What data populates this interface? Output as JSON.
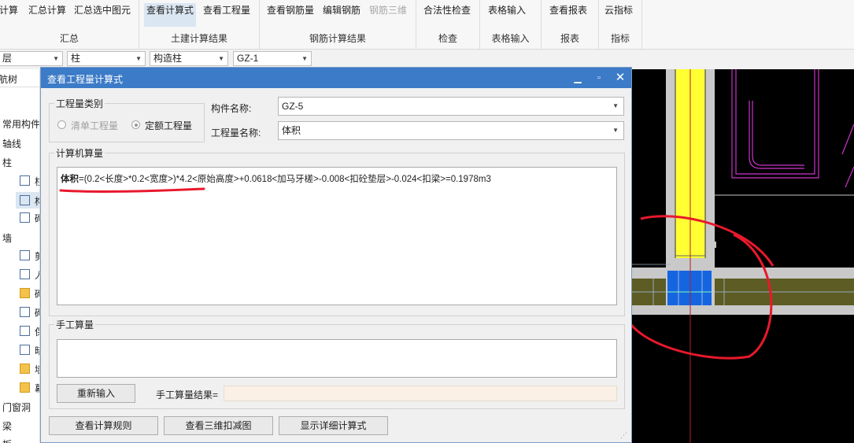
{
  "ribbon": {
    "groups": [
      {
        "label": "汇总",
        "buttons": [
          "计算",
          "汇总计算",
          "汇总选中图元"
        ]
      },
      {
        "label": "土建计算结果",
        "buttons": [
          "查看计算式",
          "查看工程量"
        ]
      },
      {
        "label": "钢筋计算结果",
        "buttons": [
          "查看钢筋量",
          "编辑钢筋",
          "钢筋三维"
        ]
      },
      {
        "label": "检查",
        "buttons": [
          "合法性检查"
        ]
      },
      {
        "label": "表格输入",
        "buttons": [
          "表格输入"
        ]
      },
      {
        "label": "报表",
        "buttons": [
          "查看报表"
        ]
      },
      {
        "label": "指标",
        "buttons": [
          "云指标"
        ]
      }
    ]
  },
  "selectors": [
    "层",
    "柱",
    "构造柱",
    "GZ-1"
  ],
  "nav": {
    "title": "航树",
    "items": [
      "常用构件",
      "轴线",
      "柱",
      "柱",
      "构",
      "砌",
      "墙",
      "剪",
      "人",
      "砌",
      "砌",
      "保",
      "暗",
      "墙",
      "幕",
      "门窗洞",
      "梁",
      "板"
    ]
  },
  "dialog": {
    "title": "查看工程量计算式",
    "category_legend": "工程量类别",
    "radio_list": "清单工程量",
    "radio_quota": "定额工程量",
    "component_label": "构件名称:",
    "component_value": "GZ-5",
    "quantity_label": "工程量名称:",
    "quantity_value": "体积",
    "computer_legend": "计算机算量",
    "formula_bold": "体积",
    "formula_rest": "=(0.2<长度>*0.2<宽度>)*4.2<原始高度>+0.0618<加马牙槎>-0.008<扣砼垫层>-0.024<扣梁>=0.1978m3",
    "manual_legend": "手工算量",
    "reenter_button": "重新输入",
    "manual_result_label": "手工算量结果=",
    "btn_rules": "查看计算规则",
    "btn_3d": "查看三维扣减图",
    "btn_detail": "显示详细计算式"
  },
  "colors": {
    "title_bar": "#3c7bc7",
    "annotation_red": "#e8192c",
    "cad_yellow": "#ffff33",
    "cad_blue": "#1565e0",
    "cad_magenta": "#cc33cc",
    "cad_olive": "#5c5c24"
  }
}
